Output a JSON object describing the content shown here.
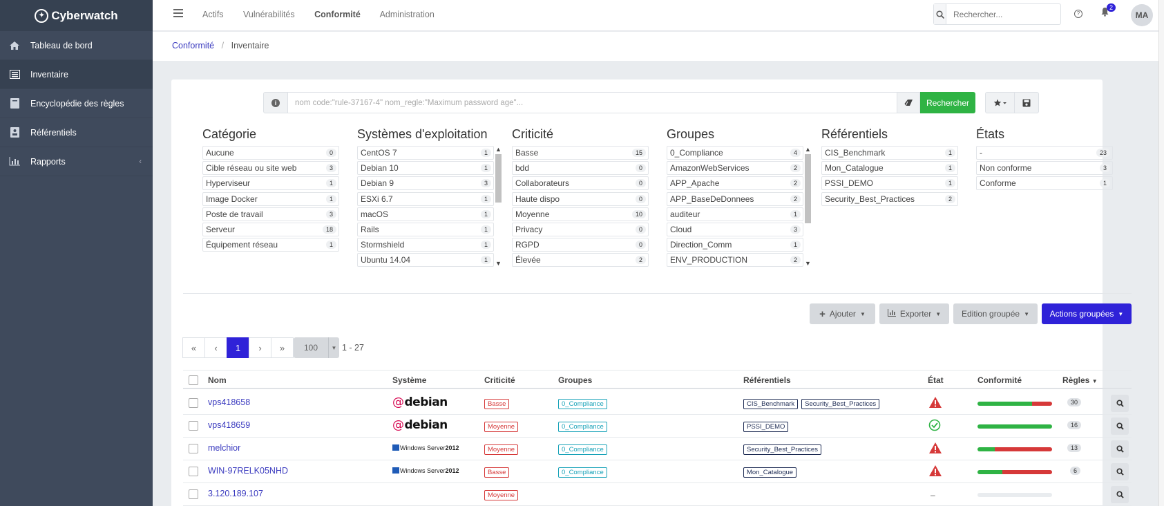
{
  "brand": {
    "name": "Cyberwatch"
  },
  "sidebar": {
    "items": [
      {
        "label": "Tableau de bord",
        "icon": "home-icon"
      },
      {
        "label": "Inventaire",
        "icon": "list-icon"
      },
      {
        "label": "Encyclopédie des règles",
        "icon": "book-icon"
      },
      {
        "label": "Référentiels",
        "icon": "id-card-icon"
      },
      {
        "label": "Rapports",
        "icon": "bar-chart-icon"
      }
    ]
  },
  "topnav": {
    "items": [
      "Actifs",
      "Vulnérabilités",
      "Conformité",
      "Administration"
    ],
    "search_placeholder": "Rechercher...",
    "notif_count": "2",
    "avatar": "MA"
  },
  "breadcrumb": {
    "parent": "Conformité",
    "current": "Inventaire"
  },
  "filter": {
    "placeholder": "nom code:\"rule-37167-4\" nom_regle:\"Maximum password age\"...",
    "search_button": "Rechercher"
  },
  "facets": [
    {
      "title": "Catégorie",
      "items": [
        {
          "label": "Aucune",
          "count": "0"
        },
        {
          "label": "Cible réseau ou site web",
          "count": "3"
        },
        {
          "label": "Hyperviseur",
          "count": "1"
        },
        {
          "label": "Image Docker",
          "count": "1"
        },
        {
          "label": "Poste de travail",
          "count": "3"
        },
        {
          "label": "Serveur",
          "count": "18"
        },
        {
          "label": "Équipement réseau",
          "count": "1"
        }
      ]
    },
    {
      "title": "Systèmes d'exploitation",
      "items": [
        {
          "label": "CentOS 7",
          "count": "1"
        },
        {
          "label": "Debian 10",
          "count": "1"
        },
        {
          "label": "Debian 9",
          "count": "3"
        },
        {
          "label": "ESXi 6.7",
          "count": "1"
        },
        {
          "label": "macOS",
          "count": "1"
        },
        {
          "label": "Rails",
          "count": "1"
        },
        {
          "label": "Stormshield",
          "count": "1"
        },
        {
          "label": "Ubuntu 14.04",
          "count": "1"
        }
      ]
    },
    {
      "title": "Criticité",
      "items": [
        {
          "label": "Basse",
          "count": "15"
        },
        {
          "label": "bdd",
          "count": "0"
        },
        {
          "label": "Collaborateurs",
          "count": "0"
        },
        {
          "label": "Haute dispo",
          "count": "0"
        },
        {
          "label": "Moyenne",
          "count": "10"
        },
        {
          "label": "Privacy",
          "count": "0"
        },
        {
          "label": "RGPD",
          "count": "0"
        },
        {
          "label": "Élevée",
          "count": "2"
        }
      ]
    },
    {
      "title": "Groupes",
      "items": [
        {
          "label": "0_Compliance",
          "count": "4"
        },
        {
          "label": "AmazonWebServices",
          "count": "2"
        },
        {
          "label": "APP_Apache",
          "count": "2"
        },
        {
          "label": "APP_BaseDeDonnees",
          "count": "2"
        },
        {
          "label": "auditeur",
          "count": "1"
        },
        {
          "label": "Cloud",
          "count": "3"
        },
        {
          "label": "Direction_Comm",
          "count": "1"
        },
        {
          "label": "ENV_PRODUCTION",
          "count": "2"
        }
      ]
    },
    {
      "title": "Référentiels",
      "items": [
        {
          "label": "CIS_Benchmark",
          "count": "1"
        },
        {
          "label": "Mon_Catalogue",
          "count": "1"
        },
        {
          "label": "PSSI_DEMO",
          "count": "1"
        },
        {
          "label": "Security_Best_Practices",
          "count": "2"
        }
      ]
    },
    {
      "title": "États",
      "items": [
        {
          "label": "-",
          "count": "23"
        },
        {
          "label": "Non conforme",
          "count": "3"
        },
        {
          "label": "Conforme",
          "count": "1"
        }
      ]
    }
  ],
  "actions": {
    "add": "Ajouter",
    "export": "Exporter",
    "bulk_edit": "Edition groupée",
    "bulk_actions": "Actions groupées"
  },
  "pagination": {
    "current": "1",
    "per_page": "100",
    "range": "1 - 27"
  },
  "table": {
    "headers": {
      "name": "Nom",
      "system": "Système",
      "criticity": "Criticité",
      "groups": "Groupes",
      "referentials": "Référentiels",
      "state": "État",
      "conformity": "Conformité",
      "rules": "Règles"
    },
    "rows": [
      {
        "name": "vps418658",
        "system": "debian",
        "criticity": "Basse",
        "groups": [
          "0_Compliance"
        ],
        "referentials": [
          "CIS_Benchmark",
          "Security_Best_Practices"
        ],
        "state": "warning",
        "conformity": 0.73,
        "rules": "30"
      },
      {
        "name": "vps418659",
        "system": "debian",
        "criticity": "Moyenne",
        "groups": [
          "0_Compliance"
        ],
        "referentials": [
          "PSSI_DEMO"
        ],
        "state": "ok",
        "conformity": 1.0,
        "rules": "16"
      },
      {
        "name": "melchior",
        "system": "windows",
        "system_label": "Windows Server",
        "system_version": "2012",
        "criticity": "Moyenne",
        "groups": [
          "0_Compliance"
        ],
        "referentials": [
          "Security_Best_Practices"
        ],
        "state": "warning",
        "conformity": 0.23,
        "rules": "13"
      },
      {
        "name": "WIN-97RELK05NHD",
        "system": "windows",
        "system_label": "Windows Server",
        "system_version": "2012",
        "criticity": "Basse",
        "groups": [
          "0_Compliance"
        ],
        "referentials": [
          "Mon_Catalogue"
        ],
        "state": "warning",
        "conformity": 0.33,
        "rules": "6"
      },
      {
        "name": "3.120.189.107",
        "system": "",
        "criticity": "Moyenne",
        "groups": [],
        "referentials": [],
        "state": "none",
        "state_text": "–",
        "conformity": null,
        "rules": ""
      }
    ]
  },
  "colors": {
    "accent": "#2f22d8",
    "success": "#2fb344",
    "danger": "#d63939",
    "sidebar": "#3f4a5c"
  }
}
